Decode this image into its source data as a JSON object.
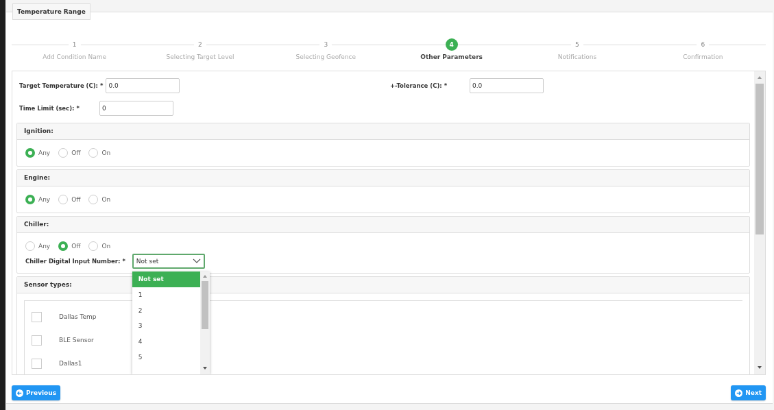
{
  "panel": {
    "title": "Temperature Range"
  },
  "steps": [
    {
      "number": "1",
      "label": "Add Condition Name",
      "selected": false
    },
    {
      "number": "2",
      "label": "Selecting Target Level",
      "selected": false
    },
    {
      "number": "3",
      "label": "Selecting Geofence",
      "selected": false
    },
    {
      "number": "4",
      "label": "Other Parameters",
      "selected": true
    },
    {
      "number": "5",
      "label": "Notifications",
      "selected": false
    },
    {
      "number": "6",
      "label": "Confirmation",
      "selected": false
    }
  ],
  "fields": [
    {
      "label": "Target Temperature (C): *",
      "value": "0.0"
    },
    {
      "label": "+-Tolerance (C): *",
      "value": "0.0"
    },
    {
      "label": "Time Limit (sec):  *",
      "value": "0"
    }
  ],
  "groups": [
    {
      "title": "Ignition:",
      "options": [
        {
          "label": "Any",
          "selected": true
        },
        {
          "label": "Off",
          "selected": false
        },
        {
          "label": "On",
          "selected": false
        }
      ]
    },
    {
      "title": "Engine:",
      "options": [
        {
          "label": "Any",
          "selected": true
        },
        {
          "label": "Off",
          "selected": false
        },
        {
          "label": "On",
          "selected": false
        }
      ]
    },
    {
      "title": "Chiller:",
      "options": [
        {
          "label": "Any",
          "selected": false
        },
        {
          "label": "Off",
          "selected": true
        },
        {
          "label": "On",
          "selected": false
        }
      ],
      "select": {
        "label": "Chiller Digital Input Number:  *",
        "value": "Not set",
        "options": [
          {
            "label": "Not set",
            "selected": true
          },
          {
            "label": "1",
            "selected": false
          },
          {
            "label": "2",
            "selected": false
          },
          {
            "label": "3",
            "selected": false
          },
          {
            "label": "4",
            "selected": false
          },
          {
            "label": "5",
            "selected": false
          }
        ]
      }
    }
  ],
  "sensors": {
    "title": "Sensor types:",
    "items": [
      {
        "label": "Dallas Temp",
        "checked": false
      },
      {
        "label": "BLE Sensor",
        "checked": false
      },
      {
        "label": "Dallas1",
        "checked": false
      }
    ]
  },
  "buttons": [
    {
      "label": "Previous",
      "kind": "previous"
    },
    {
      "label": "Next",
      "kind": "next"
    }
  ]
}
